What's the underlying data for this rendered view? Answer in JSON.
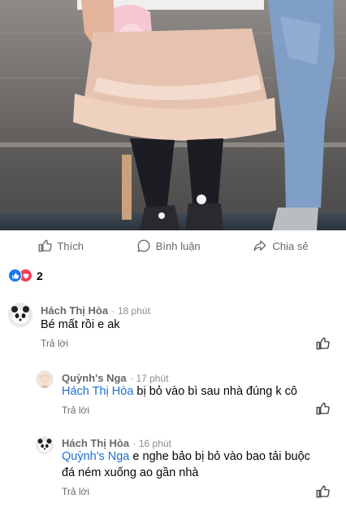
{
  "post_actions": {
    "like_label": "Thích",
    "comment_label": "Bình luận",
    "share_label": "Chia sẻ"
  },
  "reactions": {
    "count": "2",
    "icons": [
      "like-reaction-icon",
      "love-reaction-icon"
    ]
  },
  "comments": [
    {
      "author": "Hách Thị Hòa",
      "time": "· 18 phút",
      "text": "Bé mất rồi e ak",
      "reply_label": "Trả lời"
    },
    {
      "author": "Quỳnh's Nga",
      "time": "· 17 phút",
      "mention": "Hách Thị Hòa",
      "text": "bị bỏ vào bì sau nhà đúng k cô",
      "reply_label": "Trả lời"
    },
    {
      "author": "Hách Thị Hòa",
      "time": "· 16 phút",
      "mention": "Quỳnh's Nga",
      "text_line1": "e nghe bảo bị bỏ vào bao tải buộc",
      "text_line2": "đá ném xuống ao gần nhà",
      "reply_label": "Trả lời"
    }
  ],
  "colors": {
    "link_blue": "#1b6fd1",
    "like_blue": "#1877f2",
    "love_red": "#f33e58",
    "secondary_text": "#65676b"
  }
}
